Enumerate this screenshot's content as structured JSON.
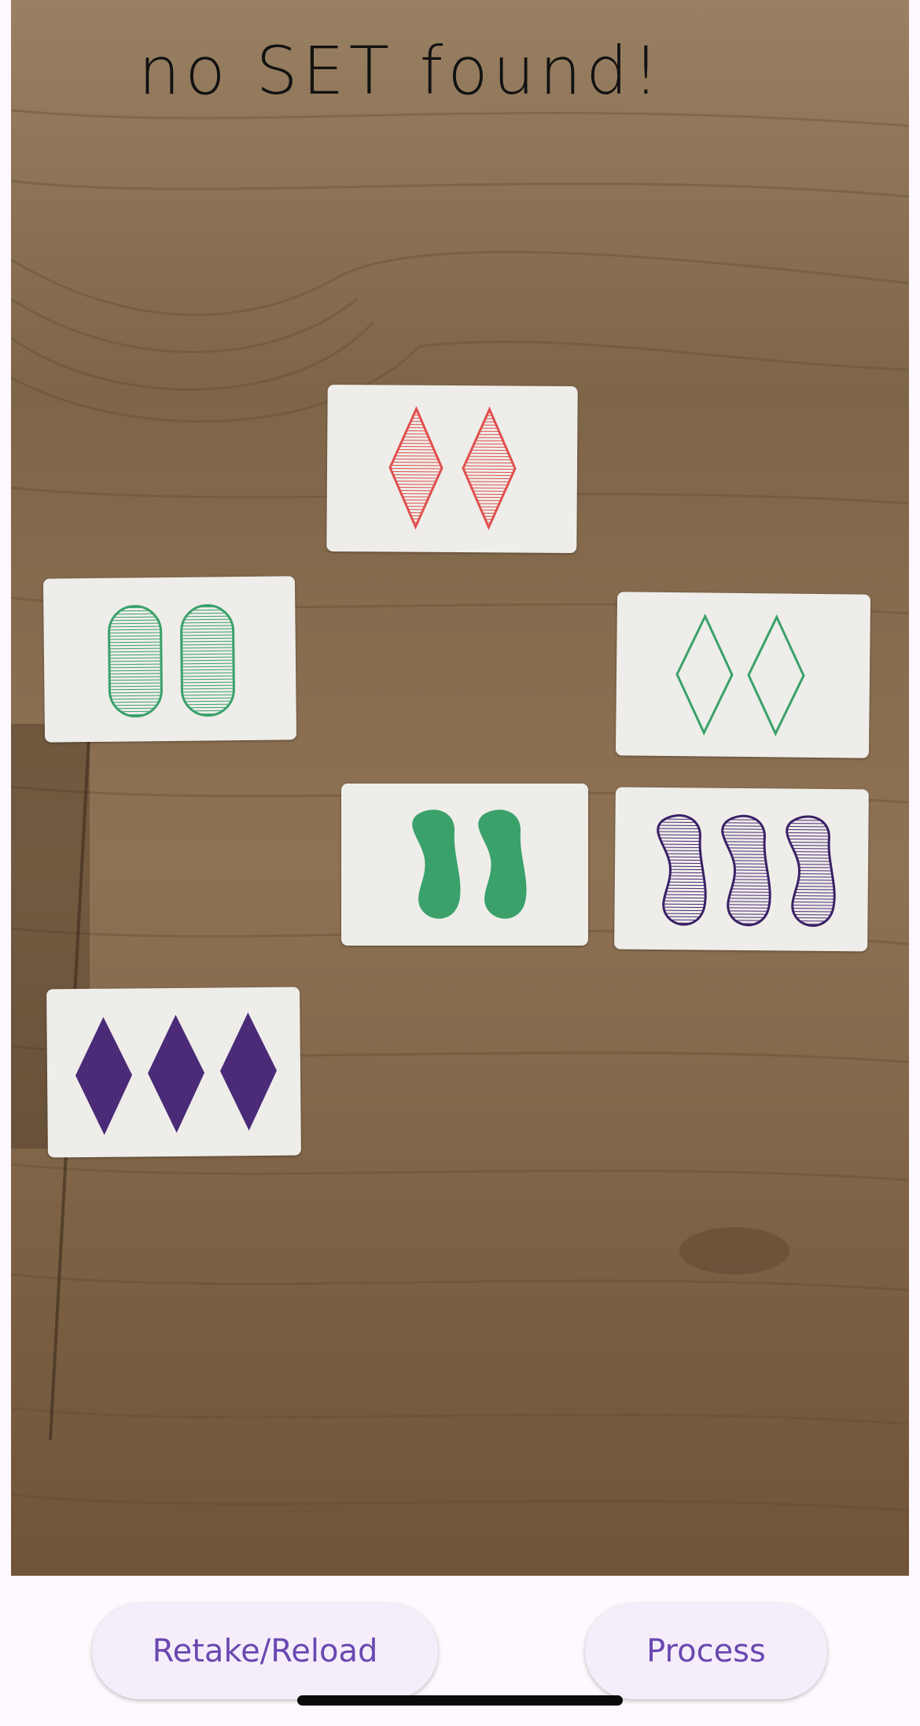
{
  "status": {
    "message": "no SET found!"
  },
  "buttons": {
    "retake_label": "Retake/Reload",
    "process_label": "Process"
  },
  "colors": {
    "button_bg": "#f5eefa",
    "button_text": "#6a48b0",
    "card_red": "#e0504e",
    "card_green": "#3aa16a",
    "card_purple": "#4b2a78",
    "table_wood": "#8d7355"
  },
  "cards": [
    {
      "name": "card-two-red-striped-diamonds",
      "count": 2,
      "color": "red",
      "shape": "diamond",
      "shading": "striped"
    },
    {
      "name": "card-two-green-striped-ovals",
      "count": 2,
      "color": "green",
      "shape": "oval",
      "shading": "striped"
    },
    {
      "name": "card-two-green-open-diamonds",
      "count": 2,
      "color": "green",
      "shape": "diamond",
      "shading": "open"
    },
    {
      "name": "card-two-green-solid-squiggles",
      "count": 2,
      "color": "green",
      "shape": "squiggle",
      "shading": "solid"
    },
    {
      "name": "card-three-purple-striped-squiggles",
      "count": 3,
      "color": "purple",
      "shape": "squiggle",
      "shading": "striped"
    },
    {
      "name": "card-three-purple-solid-diamonds",
      "count": 3,
      "color": "purple",
      "shape": "diamond",
      "shading": "solid"
    }
  ]
}
